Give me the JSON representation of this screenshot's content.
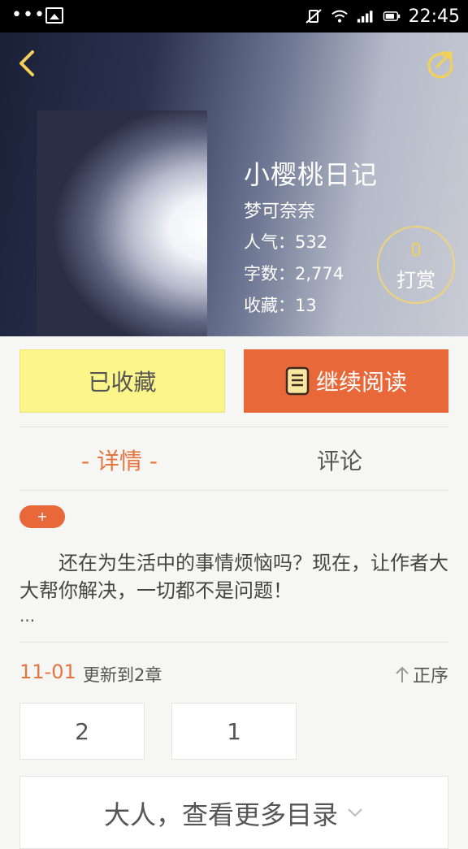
{
  "status_bar": {
    "time": "22:45",
    "dots": "•••"
  },
  "book": {
    "title": "小樱桃日记",
    "author": "梦可奈奈",
    "popularity": "人气：532",
    "word_count": "字数：2,774",
    "favorites": "收藏：13",
    "reward_count": "0",
    "reward_label": "打赏"
  },
  "actions": {
    "favorited_label": "已收藏",
    "continue_label": "继续阅读"
  },
  "tabs": [
    {
      "label": "- 详情 -",
      "active": true
    },
    {
      "label": "评论",
      "active": false
    }
  ],
  "detail": {
    "expand_label": "+",
    "description": "还在为生活中的事情烦恼吗？现在，让作者大大帮你解决，一切都不是问题！",
    "ellipsis": "..."
  },
  "update": {
    "date": "11-01",
    "text": "更新到2章",
    "order_label": "正序"
  },
  "chapters": [
    "2",
    "1"
  ],
  "more_catalog_label": "大人，查看更多目录",
  "colors": {
    "accent": "#e8683a",
    "favorite_bg": "#fbf58a",
    "reward_ring": "#f0d37a"
  }
}
